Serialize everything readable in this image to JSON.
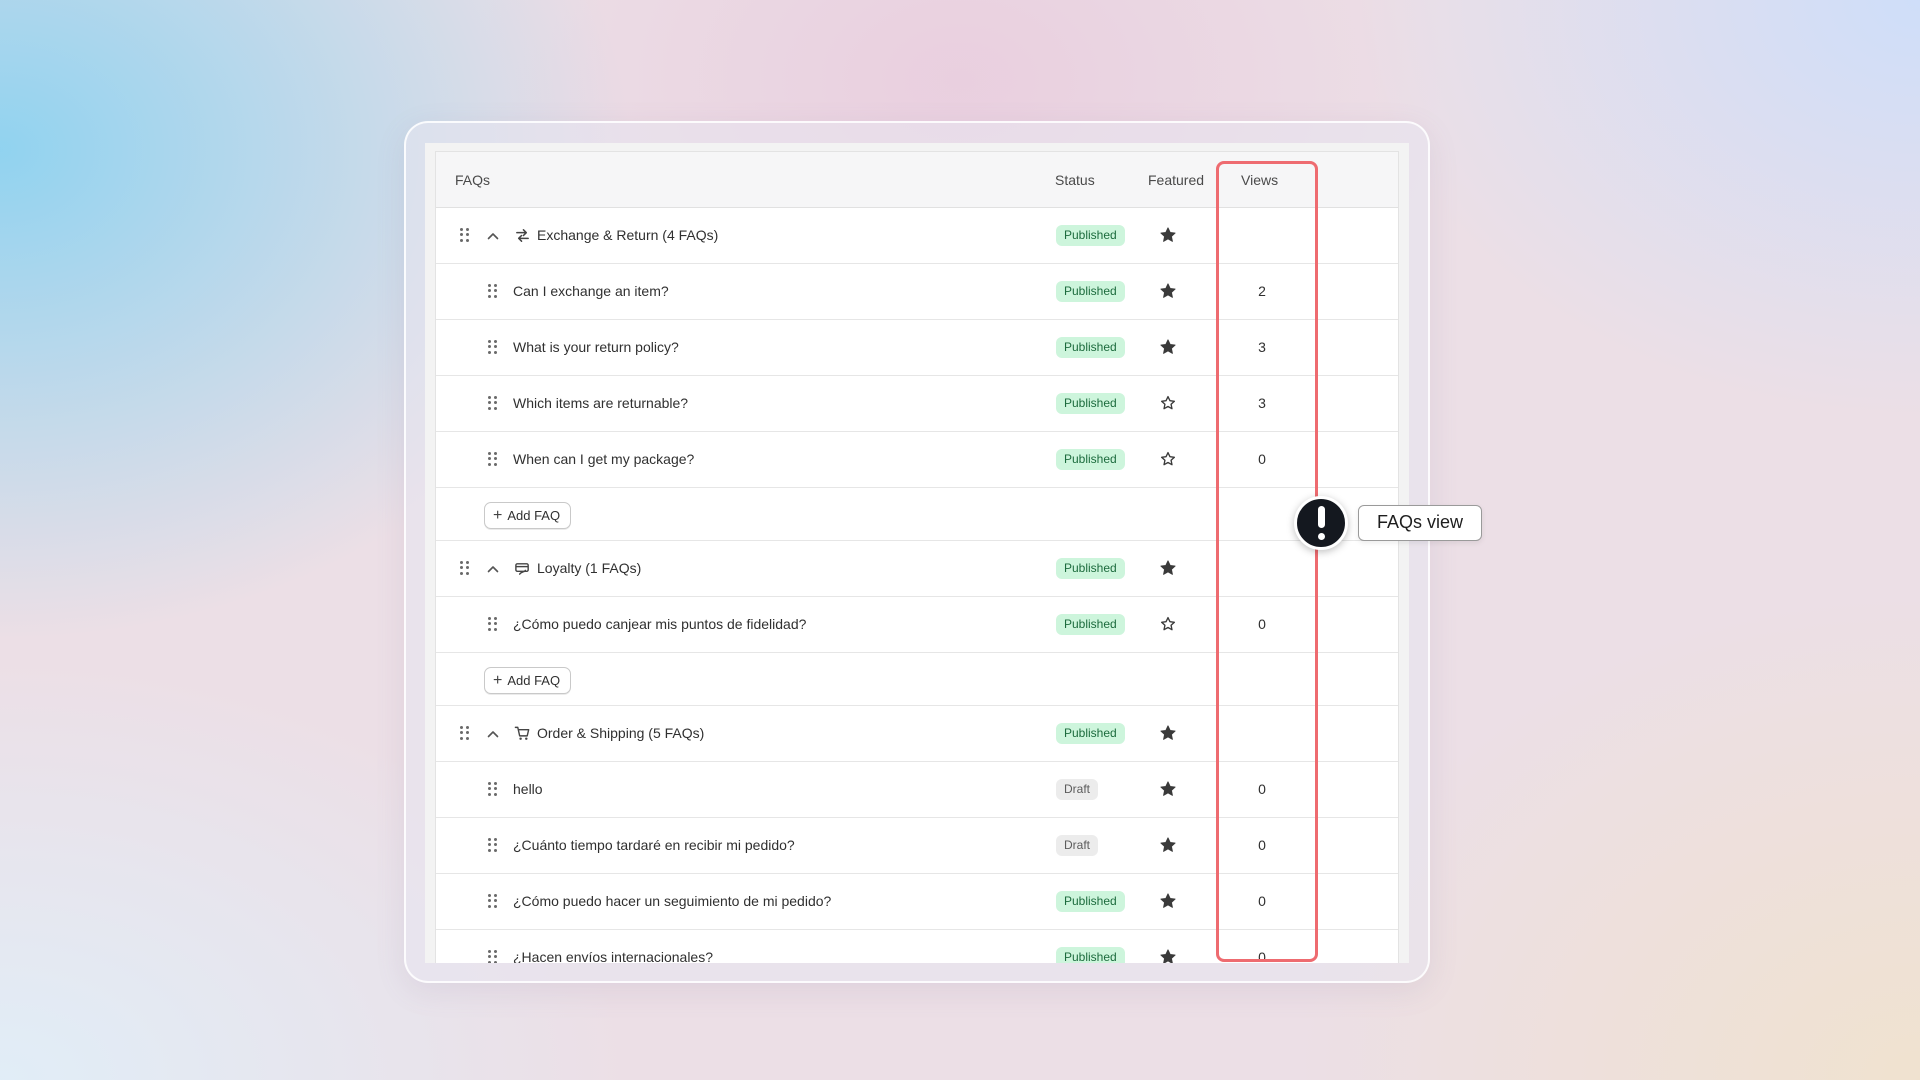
{
  "table": {
    "headers": {
      "faqs": "FAQs",
      "status": "Status",
      "featured": "Featured",
      "views": "Views"
    },
    "add_label": "Add FAQ"
  },
  "groups": [
    {
      "title": "Exchange & Return (4 FAQs)",
      "icon": "exchange-icon",
      "status": "Published",
      "featured": true,
      "items": [
        {
          "question": "Can I exchange an item?",
          "status": "Published",
          "featured": true,
          "views": "2"
        },
        {
          "question": "What is your return policy?",
          "status": "Published",
          "featured": true,
          "views": "3"
        },
        {
          "question": "Which items are returnable?",
          "status": "Published",
          "featured": false,
          "views": "3"
        },
        {
          "question": "When can I get my package?",
          "status": "Published",
          "featured": false,
          "views": "0"
        }
      ]
    },
    {
      "title": "Loyalty (1 FAQs)",
      "icon": "loyalty-icon",
      "status": "Published",
      "featured": true,
      "items": [
        {
          "question": "¿Cómo puedo canjear mis puntos de fidelidad?",
          "status": "Published",
          "featured": false,
          "views": "0"
        }
      ]
    },
    {
      "title": "Order & Shipping (5 FAQs)",
      "icon": "cart-icon",
      "status": "Published",
      "featured": true,
      "items": [
        {
          "question": "hello",
          "status": "Draft",
          "featured": true,
          "views": "0"
        },
        {
          "question": "¿Cuánto tiempo tardaré en recibir mi pedido?",
          "status": "Draft",
          "featured": true,
          "views": "0"
        },
        {
          "question": "¿Cómo puedo hacer un seguimiento de mi pedido?",
          "status": "Published",
          "featured": true,
          "views": "0"
        },
        {
          "question": "¿Hacen envíos internacionales?",
          "status": "Published",
          "featured": true,
          "views": "0"
        }
      ]
    }
  ],
  "callout": {
    "label": "FAQs view"
  },
  "colors": {
    "highlight": "#ee6b70",
    "published_bg": "#cdf5dc",
    "draft_bg": "#ececec"
  }
}
